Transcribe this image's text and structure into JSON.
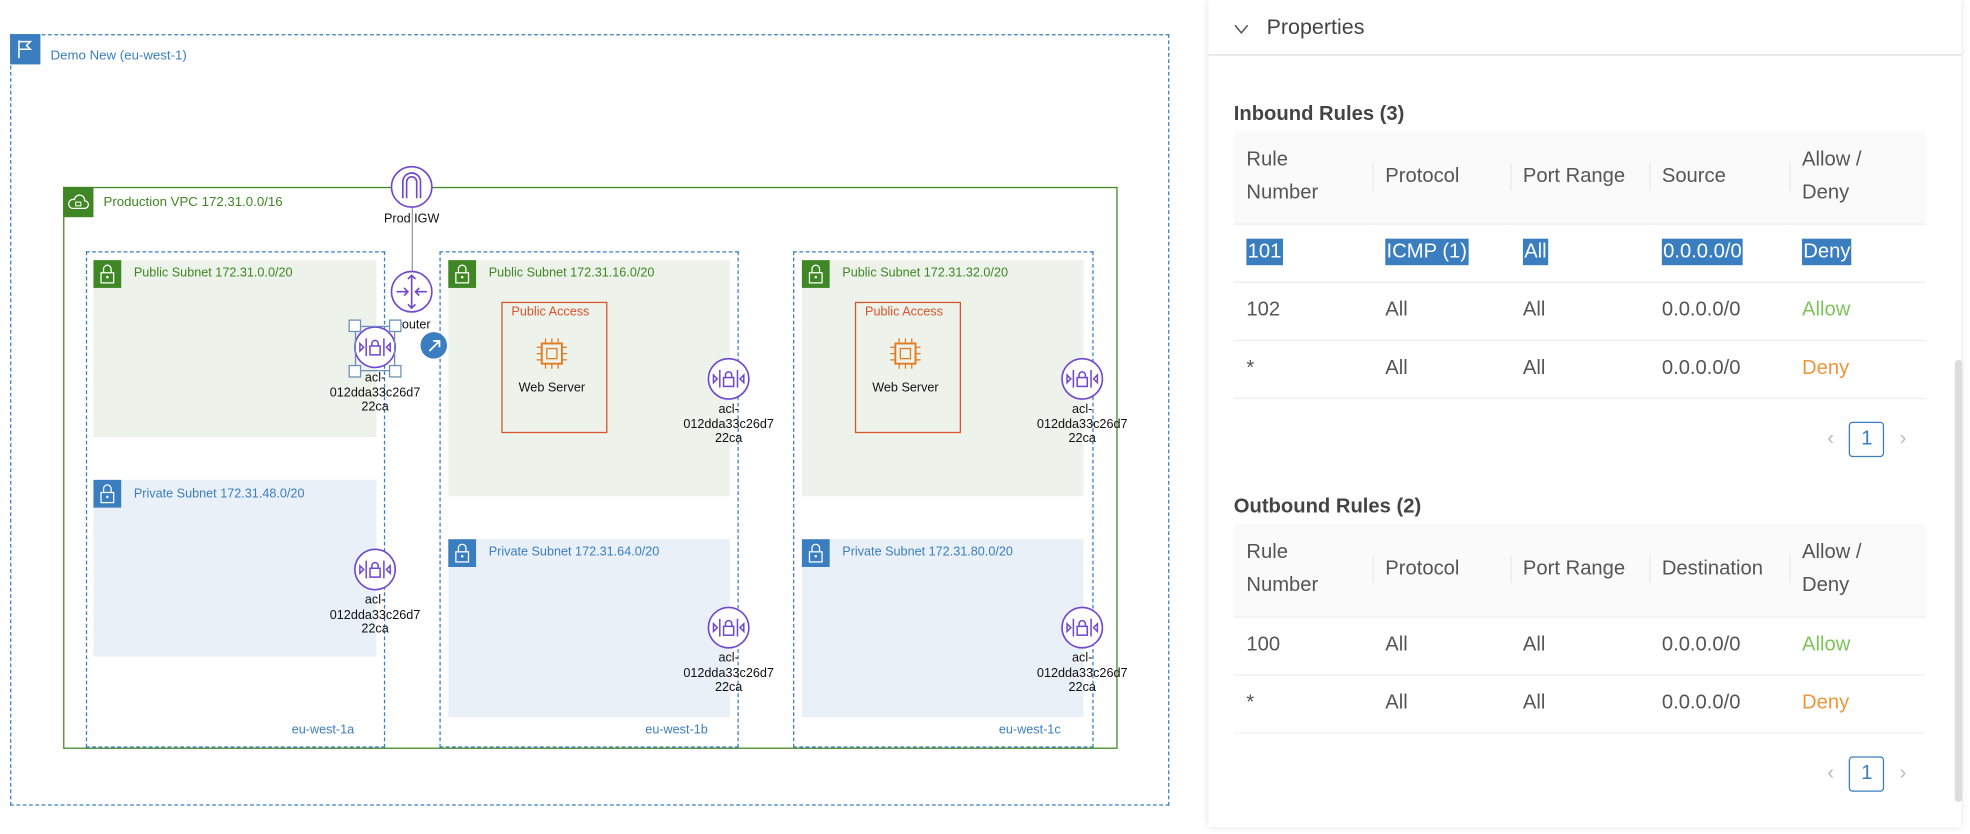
{
  "diagram": {
    "region": {
      "label": "Demo New (eu-west-1)",
      "icon": "flag-icon"
    },
    "vpc": {
      "label": "Production VPC 172.31.0.0/16",
      "icon": "cloud-lock-icon"
    },
    "igw": {
      "label": "Prod IGW"
    },
    "router": {
      "label": "Router"
    },
    "azs": [
      {
        "label": "eu-west-1a"
      },
      {
        "label": "eu-west-1b"
      },
      {
        "label": "eu-west-1c"
      }
    ],
    "public_subnets": [
      {
        "label": "Public Subnet 172.31.0.0/20"
      },
      {
        "label": "Public Subnet 172.31.16.0/20"
      },
      {
        "label": "Public Subnet 172.31.32.0/20"
      }
    ],
    "private_subnets": [
      {
        "label": "Private Subnet 172.31.48.0/20"
      },
      {
        "label": "Private Subnet 172.31.64.0/20"
      },
      {
        "label": "Private Subnet 172.31.80.0/20"
      }
    ],
    "security_groups": [
      {
        "label": "Public Access",
        "server": "Web Server"
      },
      {
        "label": "Public Access",
        "server": "Web Server"
      }
    ],
    "acl": {
      "line1": "acl-",
      "line2": "012dda33c26d7",
      "line3": "22ca"
    },
    "colors": {
      "region": "#3a7ebf",
      "vpc": "#3f8624",
      "node": "#7048d0",
      "security_group": "#d9532b",
      "ec2": "#e07b1f"
    }
  },
  "panel": {
    "title": "Properties",
    "inbound": {
      "title": "Inbound Rules (3)",
      "headers": [
        "Rule Number",
        "Protocol",
        "Port Range",
        "Source",
        "Allow / Deny"
      ],
      "rows": [
        [
          "101",
          "ICMP (1)",
          "All",
          "0.0.0.0/0",
          "Deny"
        ],
        [
          "102",
          "All",
          "All",
          "0.0.0.0/0",
          "Allow"
        ],
        [
          "*",
          "All",
          "All",
          "0.0.0.0/0",
          "Deny"
        ]
      ],
      "page": "1"
    },
    "outbound": {
      "title": "Outbound Rules (2)",
      "headers": [
        "Rule Number",
        "Protocol",
        "Port Range",
        "Destination",
        "Allow / Deny"
      ],
      "rows": [
        [
          "100",
          "All",
          "All",
          "0.0.0.0/0",
          "Allow"
        ],
        [
          "*",
          "All",
          "All",
          "0.0.0.0/0",
          "Deny"
        ]
      ],
      "page": "1"
    },
    "colors": {
      "allow": "#7ec45a",
      "deny": "#f0953a",
      "selection": "#3a7ebf"
    }
  }
}
